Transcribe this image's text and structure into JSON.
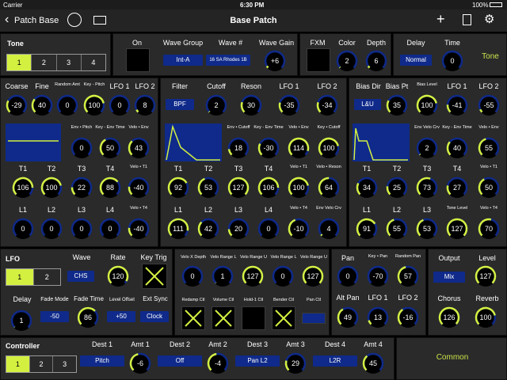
{
  "status": {
    "carrier": "Carrier",
    "time": "6:30 PM",
    "battery": "100%"
  },
  "nav": {
    "back": "Patch Base",
    "title": "Base Patch"
  },
  "tone": {
    "title": "Tone",
    "tabs": [
      "1",
      "2",
      "3",
      "4"
    ]
  },
  "top": {
    "on": "On",
    "wave_group": "Wave Group",
    "wave_num": "Wave #",
    "wave_gain": "Wave Gain",
    "wave_group_val": "Int-A",
    "wave_num_val": "16 SA Rhodes 1B",
    "wave_gain_val": "+6",
    "fxm": "FXM",
    "color": "Color",
    "depth": "Depth",
    "color_val": "2",
    "depth_val": "6",
    "delay": "Delay",
    "time": "Time",
    "delay_val": "Normal",
    "time_val": "0",
    "tone_btn": "Tone"
  },
  "pitch": {
    "r1": [
      [
        "Coarse",
        "-29"
      ],
      [
        "Fine",
        "40"
      ],
      [
        "Random Amt",
        "0"
      ],
      [
        "Key - Pitch",
        "100"
      ],
      [
        "LFO 1",
        "0"
      ],
      [
        "LFO 2",
        "8"
      ]
    ],
    "r2": [
      [
        "Env • Pitch",
        "0"
      ],
      [
        "Key - Env Time",
        "50"
      ],
      [
        "Velo • Env",
        "43"
      ]
    ],
    "r3": [
      [
        "T1",
        "106"
      ],
      [
        "T2",
        "100"
      ],
      [
        "T3",
        "22"
      ],
      [
        "T4",
        "88"
      ],
      [
        "Velo • T1",
        "-40"
      ]
    ],
    "r4": [
      [
        "L1",
        "0"
      ],
      [
        "L2",
        "0"
      ],
      [
        "L3",
        "0"
      ],
      [
        "L4",
        "0"
      ],
      [
        "Velo • T4",
        "-40"
      ]
    ]
  },
  "filter": {
    "type_label": "Filter",
    "type_val": "BPF",
    "r1": [
      [
        "Cutoff",
        "2"
      ],
      [
        "Reson",
        "30"
      ],
      [
        "LFO 1",
        "-35"
      ],
      [
        "LFO 2",
        "-34"
      ]
    ],
    "r2": [
      [
        "Env • Cutoff",
        "18"
      ],
      [
        "Key - Env Time",
        "-30"
      ],
      [
        "Velo • Env",
        "114"
      ],
      [
        "Key • Cutoff",
        "100"
      ]
    ],
    "r3": [
      [
        "T1",
        "92"
      ],
      [
        "T2",
        "53"
      ],
      [
        "T3",
        "127"
      ],
      [
        "T4",
        "106"
      ],
      [
        "Velo • T1",
        "100"
      ],
      [
        "Velo • Reson",
        "64"
      ]
    ],
    "r4": [
      [
        "L1",
        "111"
      ],
      [
        "L2",
        "42"
      ],
      [
        "L3",
        "20"
      ],
      [
        "L4",
        "0"
      ],
      [
        "Velo • T4",
        "-10"
      ],
      [
        "Env Velo Crv",
        "4"
      ]
    ]
  },
  "amp": {
    "bias_dir": "Bias Dir",
    "bias_dir_val": "L&U",
    "r1": [
      [
        "Bias Pt",
        "35"
      ],
      [
        "Bias Level",
        "100"
      ],
      [
        "LFO 1",
        "-41"
      ],
      [
        "LFO 2",
        "-55"
      ]
    ],
    "r2": [
      [
        "Env Velo Crv",
        "2"
      ],
      [
        "Key - Env Time",
        "40"
      ],
      [
        "Velo • Env",
        "55"
      ]
    ],
    "r3": [
      [
        "T1",
        "34"
      ],
      [
        "T2",
        "25"
      ],
      [
        "T3",
        "73"
      ],
      [
        "T4",
        "27"
      ],
      [
        "Velo • T1",
        "50"
      ]
    ],
    "r4": [
      [
        "L1",
        "91"
      ],
      [
        "L2",
        "55"
      ],
      [
        "L3",
        "53"
      ],
      [
        "Tone Level",
        "127"
      ],
      [
        "Velo • T4",
        "70"
      ]
    ]
  },
  "lfo": {
    "title": "LFO",
    "tabs": [
      "1",
      "2"
    ],
    "wave": "Wave",
    "wave_val": "CHS",
    "rate": "Rate",
    "rate_val": "120",
    "key_trig": "Key Trig",
    "delay": "Delay",
    "delay_val": "1",
    "fade_mode": "Fade Mode",
    "fade_mode_val": "-50",
    "fade_time": "Fade Time",
    "fade_time_val": "86",
    "level_offset": "Level Offset",
    "level_offset_val": "+50",
    "ext_sync": "Ext Sync",
    "ext_sync_val": "Clock"
  },
  "velo": {
    "r1": [
      [
        "Velo X Depth",
        "0"
      ],
      [
        "Velo Range L",
        "1"
      ],
      [
        "Velo Range U",
        "127"
      ],
      [
        "Velo Range L",
        "0"
      ],
      [
        "Velo Range U",
        "127"
      ]
    ],
    "r2": [
      "Redamp Ctl",
      "Volume Ctl",
      "Hold-1 Ctl",
      "Bender Ctl",
      "Pan Ctl"
    ]
  },
  "pan": {
    "r1": [
      [
        "Pan",
        "0"
      ],
      [
        "Key • Pan",
        "-70"
      ],
      [
        "Random Pan",
        "57"
      ]
    ],
    "r2": [
      [
        "Alt Pan",
        "49"
      ],
      [
        "LFO 1",
        "13"
      ],
      [
        "LFO 2",
        "-16"
      ]
    ]
  },
  "output": {
    "output": "Output",
    "output_val": "Mix",
    "level": "Level",
    "level_val": "127",
    "chorus": "Chorus",
    "chorus_val": "126",
    "reverb": "Reverb",
    "reverb_val": "100"
  },
  "controller": {
    "title": "Controller",
    "tabs": [
      "1",
      "2",
      "3"
    ],
    "dests": [
      [
        "Dest 1",
        "Pitch",
        "Amt 1",
        "-6"
      ],
      [
        "Dest 2",
        "Off",
        "Amt 2",
        "-4"
      ],
      [
        "Dest 3",
        "Pan L2",
        "Amt 3",
        "29"
      ],
      [
        "Dest 4",
        "L2R",
        "Amt 4",
        "45"
      ]
    ],
    "common": "Common"
  },
  "colors": {
    "accent": "#d3f041",
    "knob_bg": "#0f2a8a",
    "button": "#0f2a8a",
    "panel": "#2a2a2a"
  }
}
